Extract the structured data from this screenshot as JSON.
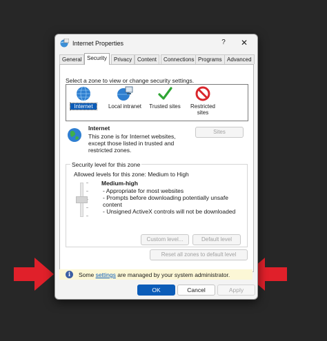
{
  "window": {
    "title": "Internet Properties",
    "help": "?",
    "close": "✕"
  },
  "tabs": [
    "General",
    "Security",
    "Privacy",
    "Content",
    "Connections",
    "Programs",
    "Advanced"
  ],
  "active_tab": "Security",
  "security": {
    "zone_prompt": "Select a zone to view or change security settings.",
    "zones": [
      {
        "label": "Internet",
        "icon": "globe-icon",
        "selected": true
      },
      {
        "label": "Local intranet",
        "icon": "intranet-globe-icon"
      },
      {
        "label": "Trusted sites",
        "icon": "checkmark-icon"
      },
      {
        "label": "Restricted sites",
        "icon": "prohibited-icon"
      }
    ],
    "zone_detail": {
      "name": "Internet",
      "description_1": "This zone is for Internet websites,",
      "description_2": "except those listed in trusted and",
      "description_3": "restricted zones.",
      "sites_button": "Sites"
    },
    "level_group": {
      "title": "Security level for this zone",
      "allowed": "Allowed levels for this zone: Medium to High",
      "level_name": "Medium-high",
      "bullet_1": "- Appropriate for most websites",
      "bullet_2": "- Prompts before downloading potentially unsafe",
      "bullet_2b": "content",
      "bullet_3": "- Unsigned ActiveX controls will not be downloaded",
      "custom_button": "Custom level...",
      "default_button": "Default level"
    },
    "reset_button": "Reset all zones to default level"
  },
  "info_bar": {
    "prefix": "Some ",
    "link": "settings",
    "suffix": " are managed by your system administrator."
  },
  "buttons": {
    "ok": "OK",
    "cancel": "Cancel",
    "apply": "Apply"
  },
  "colors": {
    "arrow": "#e0202a",
    "accent": "#0b5cb8",
    "info_bg": "#fcf7d6"
  }
}
